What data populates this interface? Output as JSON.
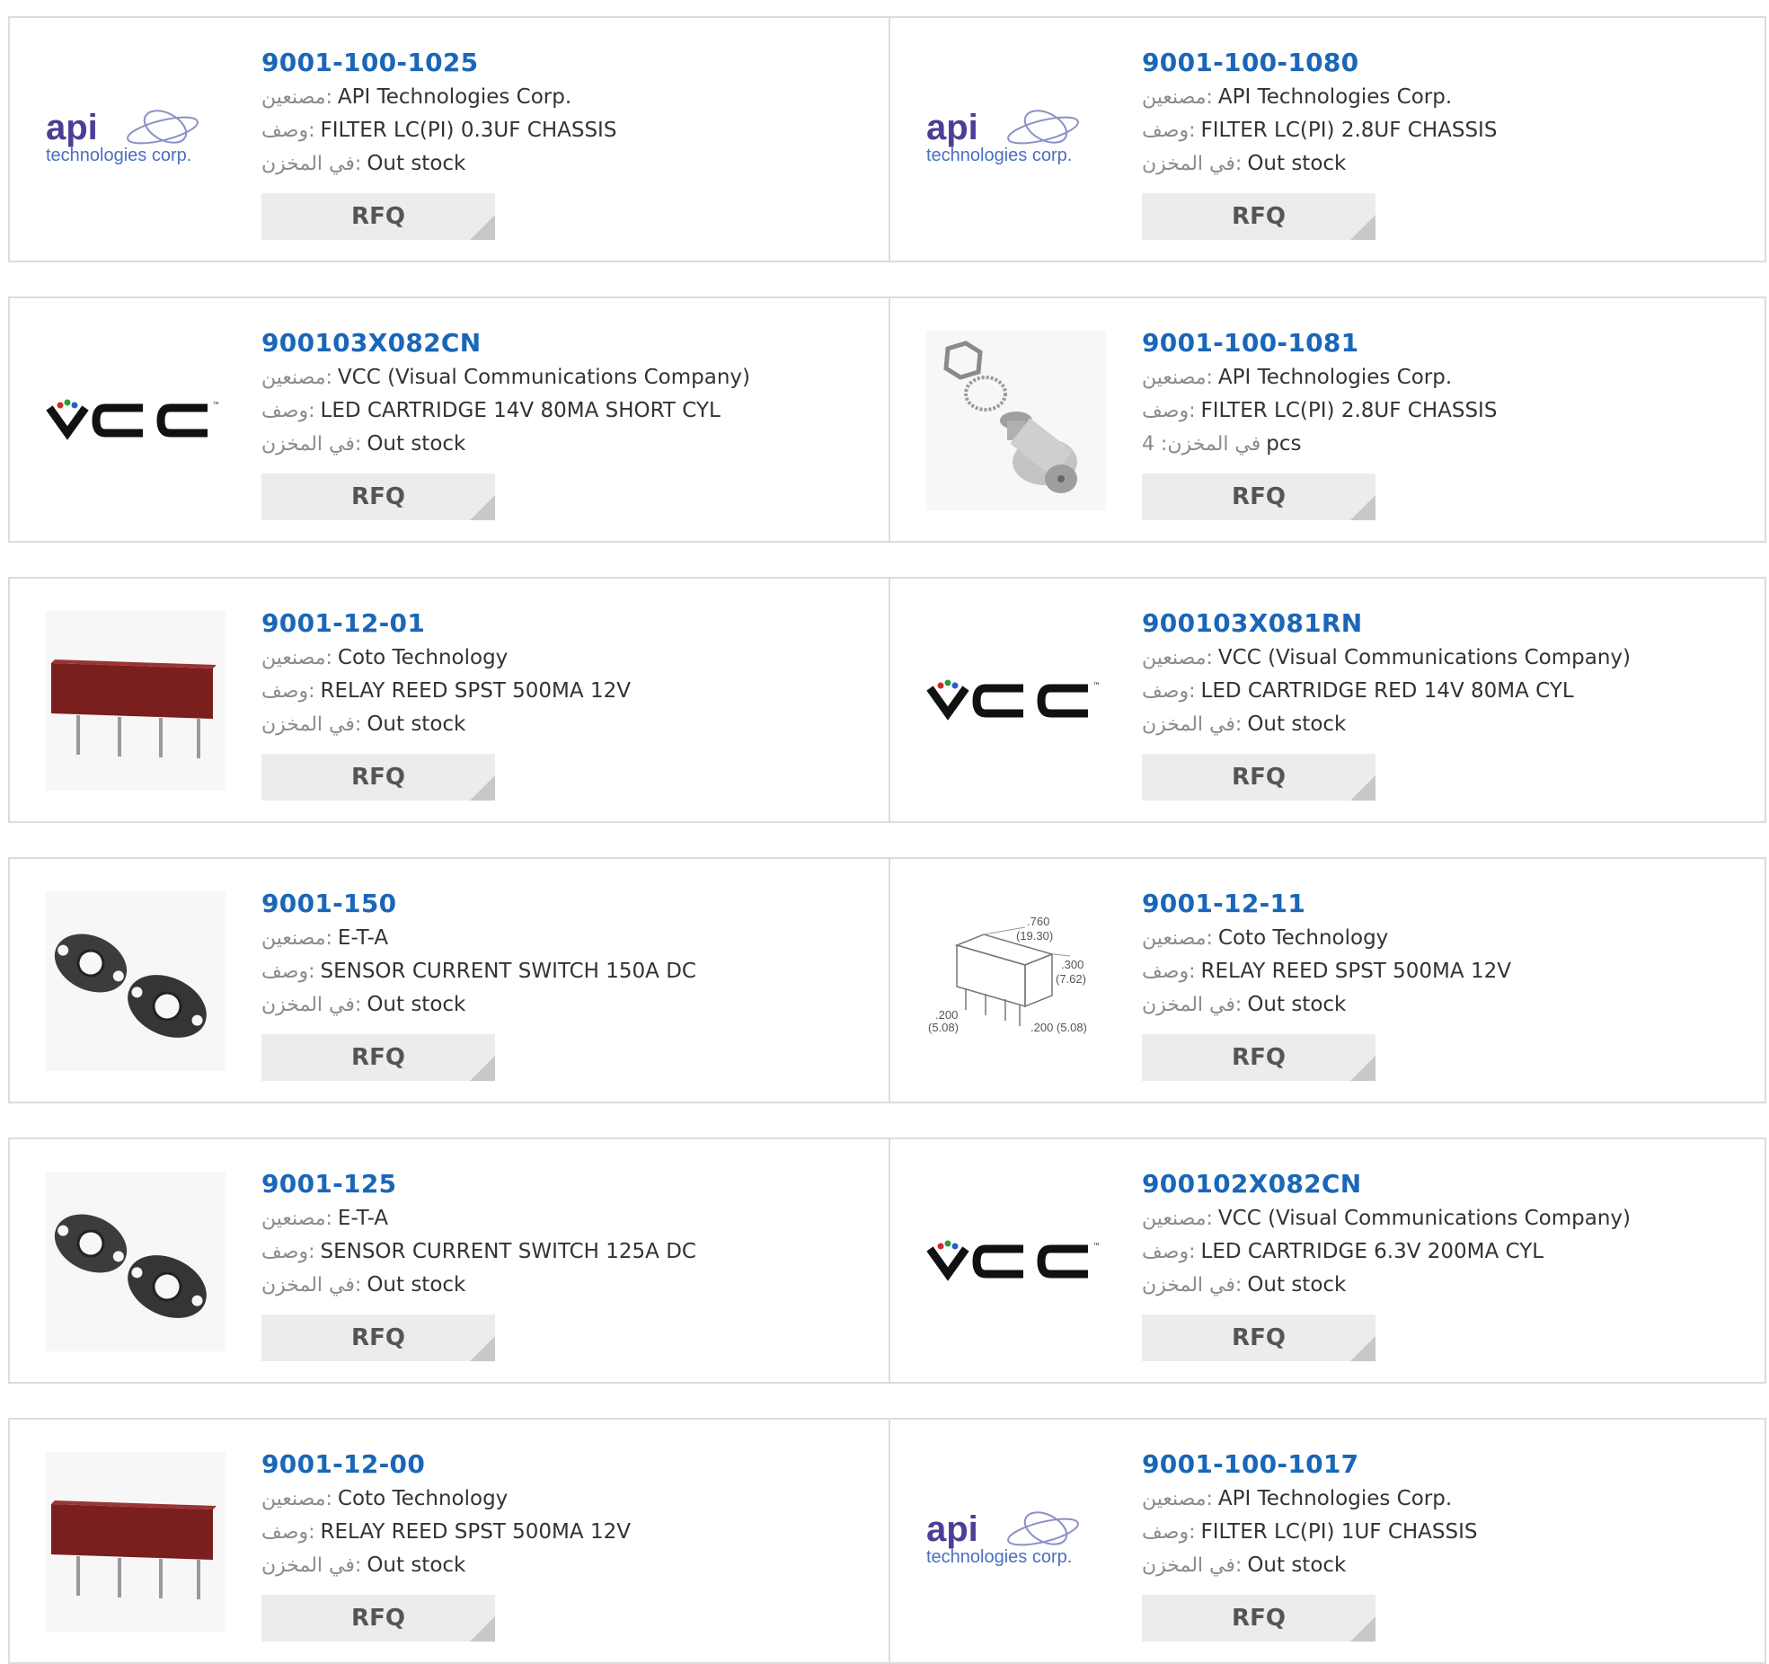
{
  "labels": {
    "manufacturer": "مصنعين:",
    "description": "وصف:",
    "in_stock": "في المخزن:",
    "in_stock_qty": "في المخزن: 4"
  },
  "rfq_label": "RFQ",
  "logos": {
    "api_word": "api",
    "api_tagline": "technologies corp.",
    "vcc_tm": "™"
  },
  "dimension_labels": [
    ".760",
    "(19.30)",
    ".300",
    "(7.62)",
    ".200",
    "(5.08)",
    ".200 (5.08)"
  ],
  "colors": {
    "part_number": "#1a66b8",
    "api_logo_text": "#4a3f96",
    "api_logo_tagline": "#4a6fc0",
    "rfq_bg": "#ececec",
    "border": "#dcdcdc"
  },
  "products": [
    {
      "part": "9001-100-1025",
      "manufacturer": "API Technologies Corp.",
      "description": "FILTER LC(PI) 0.3UF CHASSIS",
      "stock": "Out stock",
      "image": "api-logo"
    },
    {
      "part": "9001-100-1080",
      "manufacturer": "API Technologies Corp.",
      "description": "FILTER LC(PI) 2.8UF CHASSIS",
      "stock": "Out stock",
      "image": "api-logo"
    },
    {
      "part": "900103X082CN",
      "manufacturer": "VCC (Visual Communications Company)",
      "description": "LED CARTRIDGE 14V 80MA SHORT CYL",
      "stock": "Out stock",
      "image": "vcc-logo"
    },
    {
      "part": "9001-100-1081",
      "manufacturer": "API Technologies Corp.",
      "description": "FILTER LC(PI) 2.8UF CHASSIS",
      "stock": "pcs",
      "image": "filter-photo"
    },
    {
      "part": "9001-12-01",
      "manufacturer": "Coto Technology",
      "description": "RELAY REED SPST 500MA 12V",
      "stock": "Out stock",
      "image": "relay-photo"
    },
    {
      "part": "900103X081RN",
      "manufacturer": "VCC (Visual Communications Company)",
      "description": "LED CARTRIDGE RED 14V 80MA CYL",
      "stock": "Out stock",
      "image": "vcc-logo"
    },
    {
      "part": "9001-150",
      "manufacturer": "E-T-A",
      "description": "SENSOR CURRENT SWITCH 150A DC",
      "stock": "Out stock",
      "image": "sensor-photo"
    },
    {
      "part": "9001-12-11",
      "manufacturer": "Coto Technology",
      "description": "RELAY REED SPST 500MA 12V",
      "stock": "Out stock",
      "image": "relay-drawing"
    },
    {
      "part": "9001-125",
      "manufacturer": "E-T-A",
      "description": "SENSOR CURRENT SWITCH 125A DC",
      "stock": "Out stock",
      "image": "sensor-photo"
    },
    {
      "part": "900102X082CN",
      "manufacturer": "VCC (Visual Communications Company)",
      "description": "LED CARTRIDGE 6.3V 200MA CYL",
      "stock": "Out stock",
      "image": "vcc-logo"
    },
    {
      "part": "9001-12-00",
      "manufacturer": "Coto Technology",
      "description": "RELAY REED SPST 500MA 12V",
      "stock": "Out stock",
      "image": "relay-photo"
    },
    {
      "part": "9001-100-1017",
      "manufacturer": "API Technologies Corp.",
      "description": "FILTER LC(PI) 1UF CHASSIS",
      "stock": "Out stock",
      "image": "api-logo"
    }
  ]
}
